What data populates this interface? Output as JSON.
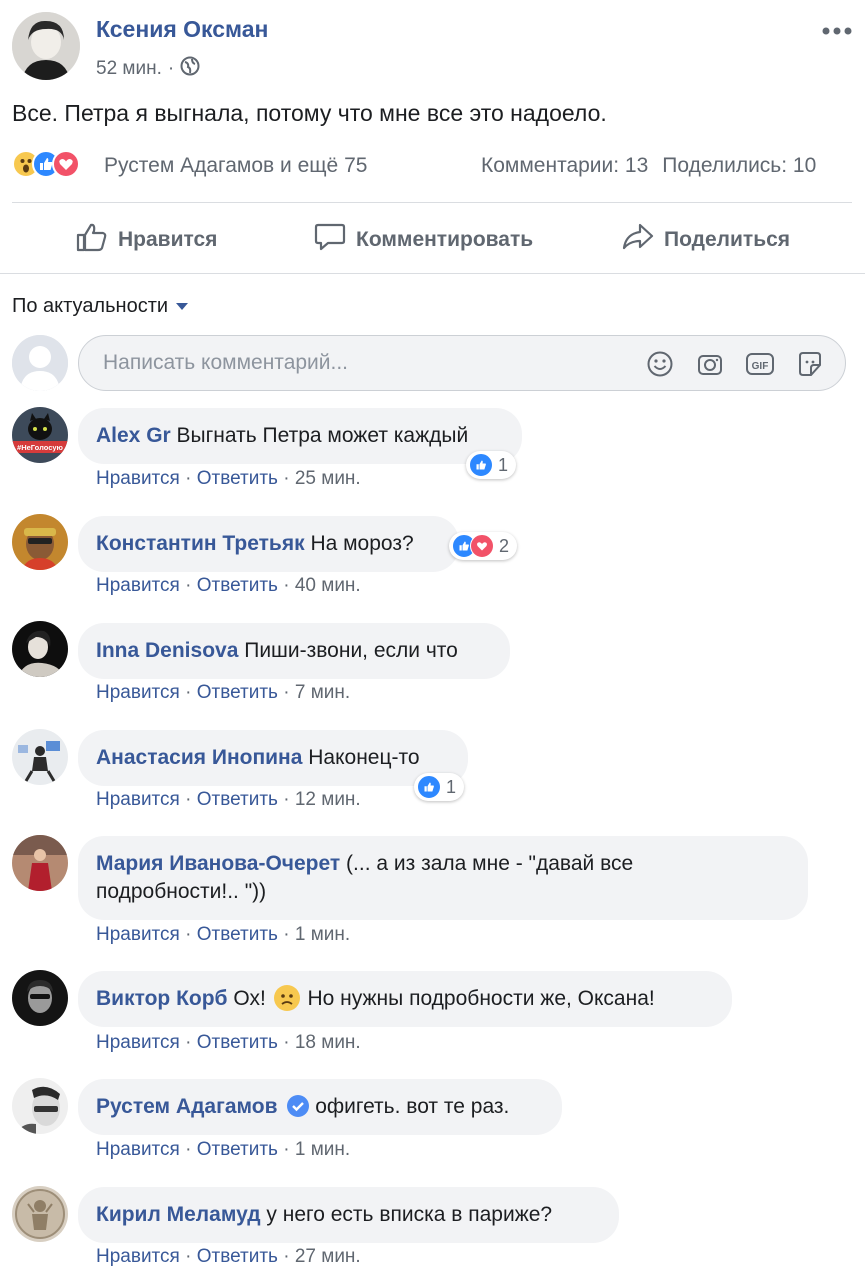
{
  "post": {
    "author": "Ксения Оксман",
    "time": "52 мин.",
    "separator": "·",
    "text": "Все. Петра я выгнала, потому что мне все это надоело.",
    "reactions_text": "Рустем Адагамов и ещё 75",
    "comments_count": "Комментарии: 13",
    "shares_count": "Поделились: 10",
    "reaction_colors": {
      "like": "#2d88ff",
      "love": "#f25268",
      "wow": "#f7c84f"
    }
  },
  "actions": {
    "like": "Нравится",
    "comment": "Комментировать",
    "share": "Поделиться"
  },
  "sort_label": "По актуальности",
  "composer": {
    "placeholder": "Написать комментарий..."
  },
  "comment_actions": {
    "like": "Нравится",
    "reply": "Ответить",
    "dot": "·"
  },
  "comments": [
    {
      "name": "Alex Gr",
      "text": "Выгнать Петра может каждый",
      "time": "25 мин.",
      "reactions": "1"
    },
    {
      "name": "Константин Третьяк",
      "text": "На мороз?",
      "time": "40 мин.",
      "reactions": "2"
    },
    {
      "name": "Inna Denisova",
      "text": "Пиши-звони, если что",
      "time": "7 мин."
    },
    {
      "name": "Анастасия Инопина",
      "text": "Наконец-то",
      "time": "12 мин.",
      "reactions": "1"
    },
    {
      "name": "Мария Иванова-Очерет",
      "text": "(... а из зала мне - \"давай все",
      "text2": "подробности!.. \"))",
      "time": "1 мин."
    },
    {
      "name": "Виктор Корб",
      "text_a": "Ох!",
      "text_b": "Но нужны подробности же, Оксана!",
      "time": "18 мин."
    },
    {
      "name": "Рустем Адагамов",
      "text": "офигеть. вот те раз.",
      "time": "1 мин."
    },
    {
      "name": "Кирил Меламуд",
      "text": "у него есть вписка в париже?",
      "time": "27 мин."
    }
  ],
  "avatar_label": "#НеГолосую",
  "accent_color": "#385898"
}
